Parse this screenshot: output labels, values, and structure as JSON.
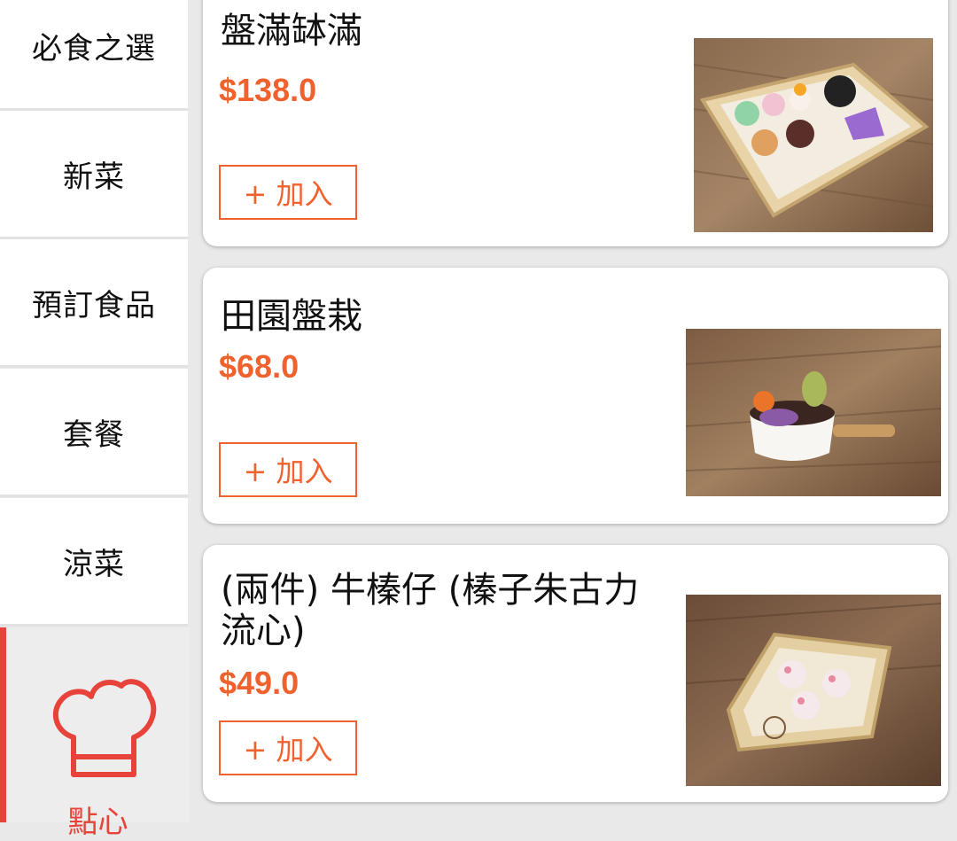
{
  "sidebar": {
    "categories": [
      {
        "label": "必食之選"
      },
      {
        "label": "新菜"
      },
      {
        "label": "預訂食品"
      },
      {
        "label": "套餐"
      },
      {
        "label": "涼菜"
      }
    ],
    "active": {
      "label": "點心",
      "icon": "chef-hat-icon"
    }
  },
  "products": [
    {
      "name": "盤滿缽滿",
      "price": "$138.0",
      "add_label": "+ 加入"
    },
    {
      "name": "田園盤栽",
      "price": "$68.0",
      "add_label": "+ 加入"
    },
    {
      "name": "(兩件) 牛榛仔 (榛子朱古力流心)",
      "price": "$49.0",
      "add_label": "+ 加入"
    }
  ],
  "colors": {
    "accent": "#f0622d",
    "active_tab": "#e8433a"
  }
}
